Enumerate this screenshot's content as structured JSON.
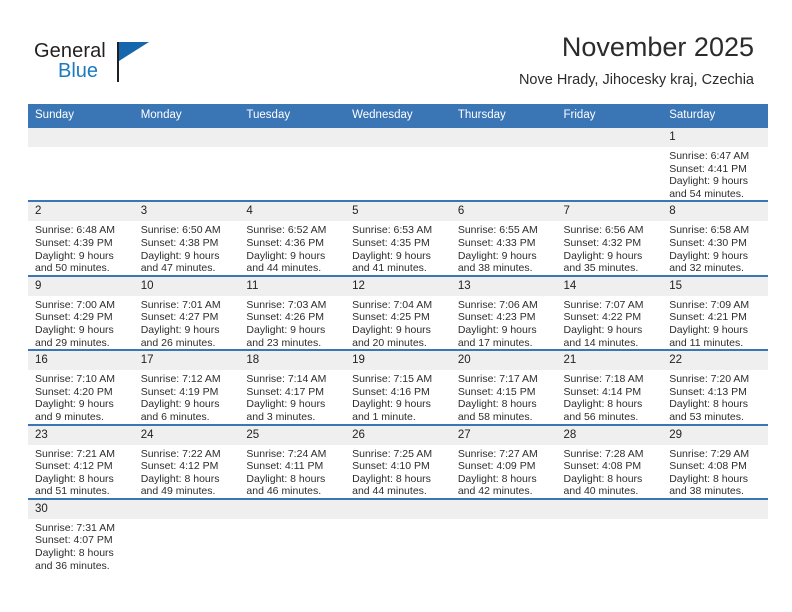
{
  "brand": {
    "name_dark": "General",
    "name_blue": "Blue",
    "accent_color": "#1566ad",
    "blue_text_color": "#1c7ac0"
  },
  "header": {
    "title": "November 2025",
    "subtitle": "Nove Hrady, Jihocesky kraj, Czechia"
  },
  "theme": {
    "header_blue": "#3a75b6",
    "daynum_gray": "#efefef",
    "text_dark": "#2d2d2d"
  },
  "calendar": {
    "weekday_headers": [
      "Sunday",
      "Monday",
      "Tuesday",
      "Wednesday",
      "Thursday",
      "Friday",
      "Saturday"
    ],
    "weeks": [
      [
        {
          "day": "",
          "empty": true
        },
        {
          "day": "",
          "empty": true
        },
        {
          "day": "",
          "empty": true
        },
        {
          "day": "",
          "empty": true
        },
        {
          "day": "",
          "empty": true
        },
        {
          "day": "",
          "empty": true
        },
        {
          "day": "1",
          "sunrise": "Sunrise: 6:47 AM",
          "sunset": "Sunset: 4:41 PM",
          "daylight_1": "Daylight: 9 hours",
          "daylight_2": "and 54 minutes."
        }
      ],
      [
        {
          "day": "2",
          "sunrise": "Sunrise: 6:48 AM",
          "sunset": "Sunset: 4:39 PM",
          "daylight_1": "Daylight: 9 hours",
          "daylight_2": "and 50 minutes."
        },
        {
          "day": "3",
          "sunrise": "Sunrise: 6:50 AM",
          "sunset": "Sunset: 4:38 PM",
          "daylight_1": "Daylight: 9 hours",
          "daylight_2": "and 47 minutes."
        },
        {
          "day": "4",
          "sunrise": "Sunrise: 6:52 AM",
          "sunset": "Sunset: 4:36 PM",
          "daylight_1": "Daylight: 9 hours",
          "daylight_2": "and 44 minutes."
        },
        {
          "day": "5",
          "sunrise": "Sunrise: 6:53 AM",
          "sunset": "Sunset: 4:35 PM",
          "daylight_1": "Daylight: 9 hours",
          "daylight_2": "and 41 minutes."
        },
        {
          "day": "6",
          "sunrise": "Sunrise: 6:55 AM",
          "sunset": "Sunset: 4:33 PM",
          "daylight_1": "Daylight: 9 hours",
          "daylight_2": "and 38 minutes."
        },
        {
          "day": "7",
          "sunrise": "Sunrise: 6:56 AM",
          "sunset": "Sunset: 4:32 PM",
          "daylight_1": "Daylight: 9 hours",
          "daylight_2": "and 35 minutes."
        },
        {
          "day": "8",
          "sunrise": "Sunrise: 6:58 AM",
          "sunset": "Sunset: 4:30 PM",
          "daylight_1": "Daylight: 9 hours",
          "daylight_2": "and 32 minutes."
        }
      ],
      [
        {
          "day": "9",
          "sunrise": "Sunrise: 7:00 AM",
          "sunset": "Sunset: 4:29 PM",
          "daylight_1": "Daylight: 9 hours",
          "daylight_2": "and 29 minutes."
        },
        {
          "day": "10",
          "sunrise": "Sunrise: 7:01 AM",
          "sunset": "Sunset: 4:27 PM",
          "daylight_1": "Daylight: 9 hours",
          "daylight_2": "and 26 minutes."
        },
        {
          "day": "11",
          "sunrise": "Sunrise: 7:03 AM",
          "sunset": "Sunset: 4:26 PM",
          "daylight_1": "Daylight: 9 hours",
          "daylight_2": "and 23 minutes."
        },
        {
          "day": "12",
          "sunrise": "Sunrise: 7:04 AM",
          "sunset": "Sunset: 4:25 PM",
          "daylight_1": "Daylight: 9 hours",
          "daylight_2": "and 20 minutes."
        },
        {
          "day": "13",
          "sunrise": "Sunrise: 7:06 AM",
          "sunset": "Sunset: 4:23 PM",
          "daylight_1": "Daylight: 9 hours",
          "daylight_2": "and 17 minutes."
        },
        {
          "day": "14",
          "sunrise": "Sunrise: 7:07 AM",
          "sunset": "Sunset: 4:22 PM",
          "daylight_1": "Daylight: 9 hours",
          "daylight_2": "and 14 minutes."
        },
        {
          "day": "15",
          "sunrise": "Sunrise: 7:09 AM",
          "sunset": "Sunset: 4:21 PM",
          "daylight_1": "Daylight: 9 hours",
          "daylight_2": "and 11 minutes."
        }
      ],
      [
        {
          "day": "16",
          "sunrise": "Sunrise: 7:10 AM",
          "sunset": "Sunset: 4:20 PM",
          "daylight_1": "Daylight: 9 hours",
          "daylight_2": "and 9 minutes."
        },
        {
          "day": "17",
          "sunrise": "Sunrise: 7:12 AM",
          "sunset": "Sunset: 4:19 PM",
          "daylight_1": "Daylight: 9 hours",
          "daylight_2": "and 6 minutes."
        },
        {
          "day": "18",
          "sunrise": "Sunrise: 7:14 AM",
          "sunset": "Sunset: 4:17 PM",
          "daylight_1": "Daylight: 9 hours",
          "daylight_2": "and 3 minutes."
        },
        {
          "day": "19",
          "sunrise": "Sunrise: 7:15 AM",
          "sunset": "Sunset: 4:16 PM",
          "daylight_1": "Daylight: 9 hours",
          "daylight_2": "and 1 minute."
        },
        {
          "day": "20",
          "sunrise": "Sunrise: 7:17 AM",
          "sunset": "Sunset: 4:15 PM",
          "daylight_1": "Daylight: 8 hours",
          "daylight_2": "and 58 minutes."
        },
        {
          "day": "21",
          "sunrise": "Sunrise: 7:18 AM",
          "sunset": "Sunset: 4:14 PM",
          "daylight_1": "Daylight: 8 hours",
          "daylight_2": "and 56 minutes."
        },
        {
          "day": "22",
          "sunrise": "Sunrise: 7:20 AM",
          "sunset": "Sunset: 4:13 PM",
          "daylight_1": "Daylight: 8 hours",
          "daylight_2": "and 53 minutes."
        }
      ],
      [
        {
          "day": "23",
          "sunrise": "Sunrise: 7:21 AM",
          "sunset": "Sunset: 4:12 PM",
          "daylight_1": "Daylight: 8 hours",
          "daylight_2": "and 51 minutes."
        },
        {
          "day": "24",
          "sunrise": "Sunrise: 7:22 AM",
          "sunset": "Sunset: 4:12 PM",
          "daylight_1": "Daylight: 8 hours",
          "daylight_2": "and 49 minutes."
        },
        {
          "day": "25",
          "sunrise": "Sunrise: 7:24 AM",
          "sunset": "Sunset: 4:11 PM",
          "daylight_1": "Daylight: 8 hours",
          "daylight_2": "and 46 minutes."
        },
        {
          "day": "26",
          "sunrise": "Sunrise: 7:25 AM",
          "sunset": "Sunset: 4:10 PM",
          "daylight_1": "Daylight: 8 hours",
          "daylight_2": "and 44 minutes."
        },
        {
          "day": "27",
          "sunrise": "Sunrise: 7:27 AM",
          "sunset": "Sunset: 4:09 PM",
          "daylight_1": "Daylight: 8 hours",
          "daylight_2": "and 42 minutes."
        },
        {
          "day": "28",
          "sunrise": "Sunrise: 7:28 AM",
          "sunset": "Sunset: 4:08 PM",
          "daylight_1": "Daylight: 8 hours",
          "daylight_2": "and 40 minutes."
        },
        {
          "day": "29",
          "sunrise": "Sunrise: 7:29 AM",
          "sunset": "Sunset: 4:08 PM",
          "daylight_1": "Daylight: 8 hours",
          "daylight_2": "and 38 minutes."
        }
      ],
      [
        {
          "day": "30",
          "sunrise": "Sunrise: 7:31 AM",
          "sunset": "Sunset: 4:07 PM",
          "daylight_1": "Daylight: 8 hours",
          "daylight_2": "and 36 minutes."
        },
        {
          "day": "",
          "empty": true
        },
        {
          "day": "",
          "empty": true
        },
        {
          "day": "",
          "empty": true
        },
        {
          "day": "",
          "empty": true
        },
        {
          "day": "",
          "empty": true
        },
        {
          "day": "",
          "empty": true
        }
      ]
    ]
  }
}
